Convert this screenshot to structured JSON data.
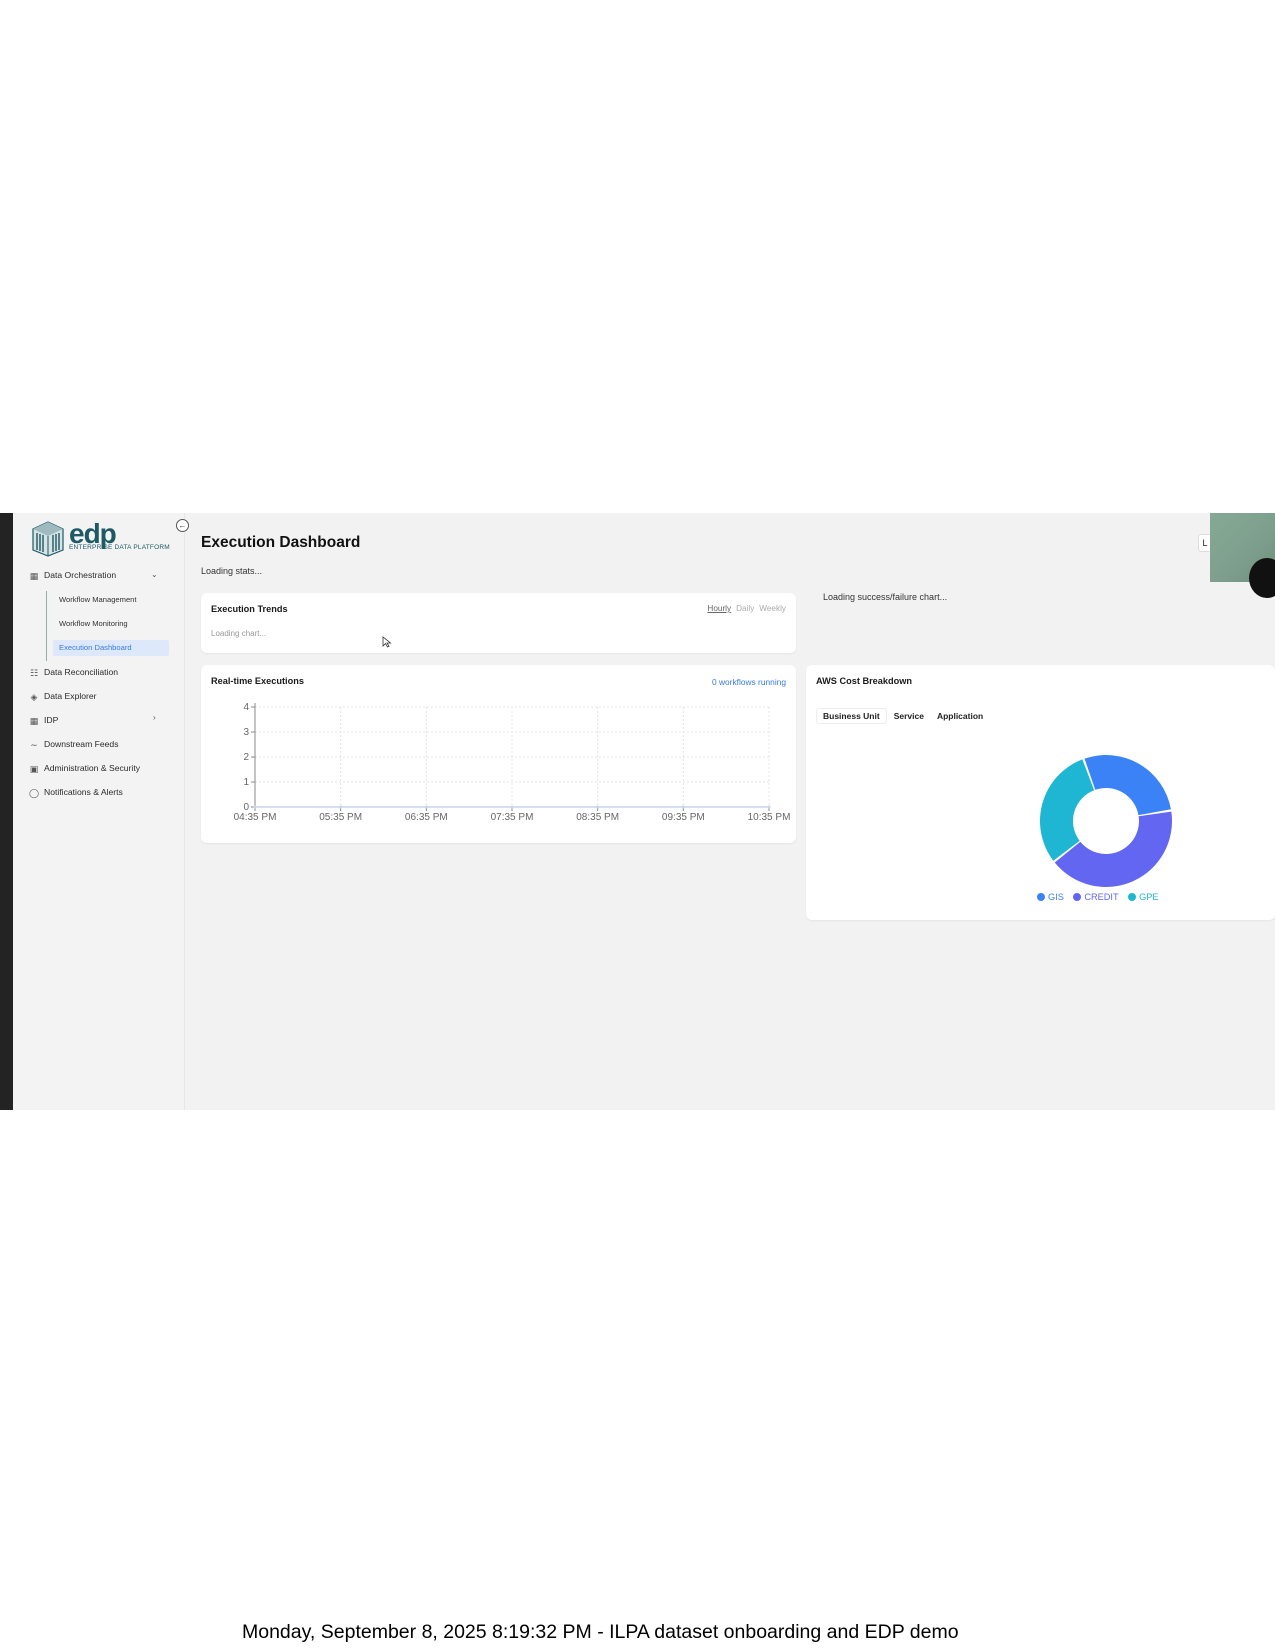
{
  "brand": {
    "name": "edp",
    "tagline": "ENTERPRISE DATA PLATFORM"
  },
  "sidebar": {
    "collapse_icon": "arrow-left-circle",
    "items": [
      {
        "label": "Data Orchestration",
        "icon": "grid-icon",
        "expanded": true
      },
      {
        "label": "Data Reconciliation",
        "icon": "nodes-icon"
      },
      {
        "label": "Data Explorer",
        "icon": "cube-icon"
      },
      {
        "label": "IDP",
        "icon": "grid-icon",
        "expandable": true
      },
      {
        "label": "Downstream Feeds",
        "icon": "trend-icon"
      },
      {
        "label": "Administration & Security",
        "icon": "calendar-icon"
      },
      {
        "label": "Notifications & Alerts",
        "icon": "bell-icon"
      }
    ],
    "subitems": [
      {
        "label": "Workflow Management"
      },
      {
        "label": "Workflow Monitoring"
      },
      {
        "label": "Execution Dashboard",
        "active": true
      }
    ]
  },
  "main": {
    "title": "Execution Dashboard",
    "loading_stats": "Loading stats...",
    "loading_success_failure": "Loading success/failure chart...",
    "execution_trends": {
      "title": "Execution Trends",
      "tabs": [
        "Hourly",
        "Daily",
        "Weekly"
      ],
      "selected_tab": "Hourly",
      "loading": "Loading chart..."
    },
    "realtime": {
      "title": "Real-time Executions",
      "running": "0 workflows running"
    },
    "aws_cost": {
      "title": "AWS Cost Breakdown",
      "tabs": [
        "Business Unit",
        "Service",
        "Application"
      ],
      "selected_tab": "Business Unit"
    }
  },
  "caption": "Monday, September 8, 2025 8:19:32 PM - ILPA dataset onboarding and EDP demo",
  "colors": {
    "accent": "#3b7be0",
    "gis": "#3b82f6",
    "credit": "#6366f1",
    "gpe": "#1fb6d4"
  },
  "chart_data": [
    {
      "type": "line",
      "title": "Real-time Executions",
      "x": [
        "04:35 PM",
        "05:35 PM",
        "06:35 PM",
        "07:35 PM",
        "08:35 PM",
        "09:35 PM",
        "10:35 PM"
      ],
      "series": [
        {
          "values": [
            0,
            0,
            0,
            0,
            0,
            0,
            0
          ]
        }
      ],
      "yticks": [
        0,
        1,
        2,
        3,
        4
      ],
      "ylim": [
        0,
        4
      ],
      "grid": true
    },
    {
      "type": "pie",
      "title": "AWS Cost Breakdown",
      "donut": true,
      "labels": [
        "GIS",
        "CREDIT",
        "GPE"
      ],
      "values": [
        28,
        42,
        30
      ],
      "legend_position": "bottom"
    }
  ]
}
